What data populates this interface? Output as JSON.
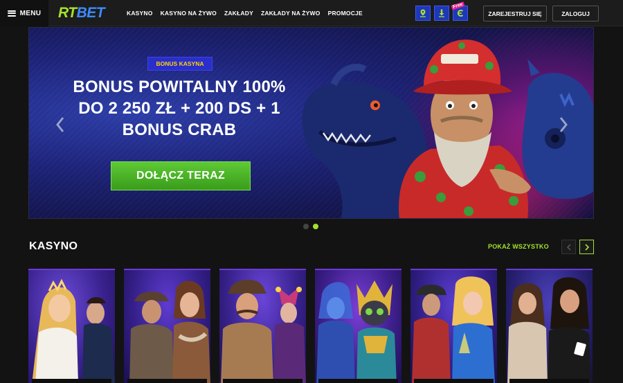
{
  "header": {
    "menu_label": "MENU",
    "logo_rt": "RT",
    "logo_bet": "BET",
    "nav": [
      "KASYNO",
      "KASYNO NA ŻYWO",
      "ZAKŁADY",
      "ZAKŁADY NA ŻYWO",
      "PROMOCJE"
    ],
    "free_tag": "Free",
    "register_label": "ZAREJESTRUJ SIĘ",
    "login_label": "ZALOGUJ"
  },
  "hero": {
    "badge": "BONUS KASYNA",
    "title_line1": "BONUS POWITALNY 100%",
    "title_line2": "DO 2 250 ZŁ + 200 DS + 1",
    "title_line3": "BONUS CRAB",
    "cta_label": "DOŁĄCZ TERAZ",
    "slides_total": 2,
    "active_slide": 2
  },
  "casino": {
    "title": "KASYNO",
    "show_all_label": "POKAŻ WSZYSTKO",
    "games": [
      {
        "icon": "goddess-and-magician-icon"
      },
      {
        "icon": "adventurers-icon"
      },
      {
        "icon": "detective-and-jester-icon"
      },
      {
        "icon": "sphinx-cat-icon"
      },
      {
        "icon": "heist-crew-icon"
      },
      {
        "icon": "live-dealers-icon"
      }
    ]
  },
  "colors": {
    "accent": "#a6e22e",
    "brand_blue": "#3d8bff",
    "badge_bg": "#2a2ecb",
    "badge_text": "#ffd400",
    "cta_green": "#4bb527"
  }
}
